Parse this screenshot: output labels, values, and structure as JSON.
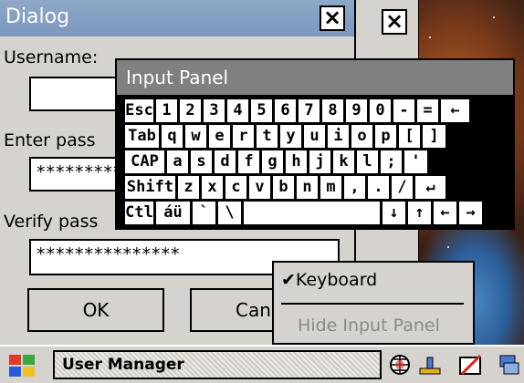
{
  "dialog": {
    "title": "Dialog",
    "username_label": "Username:",
    "username_value": "",
    "enter_pass_label": "Enter pass",
    "enter_pass_value": "*********",
    "verify_pass_label": "Verify pass",
    "verify_pass_value": "***************",
    "ok_label": "OK",
    "cancel_label": "Canc"
  },
  "input_panel": {
    "title": "Input Panel",
    "rows": [
      [
        "Esc",
        "1",
        "2",
        "3",
        "4",
        "5",
        "6",
        "7",
        "8",
        "9",
        "0",
        "-",
        "=",
        "←"
      ],
      [
        "Tab",
        "q",
        "w",
        "e",
        "r",
        "t",
        "y",
        "u",
        "i",
        "o",
        "p",
        "[",
        "]"
      ],
      [
        "CAP",
        "a",
        "s",
        "d",
        "f",
        "g",
        "h",
        "j",
        "k",
        "l",
        ";",
        "'"
      ],
      [
        "Shift",
        "z",
        "x",
        "c",
        "v",
        "b",
        "n",
        "m",
        ",",
        ".",
        "/",
        "↵"
      ],
      [
        "Ctl",
        "áü",
        "`",
        "\\",
        " ",
        "↓",
        "↑",
        "←",
        "→"
      ]
    ]
  },
  "menu": {
    "keyboard_label": "Keyboard",
    "keyboard_checked": true,
    "hide_panel_label": "Hide Input Panel"
  },
  "taskbar": {
    "task_label": "User Manager"
  },
  "colors": {
    "titlebar": "#7b97bd",
    "window_bg": "#d6d3ce",
    "panel_title": "#808080"
  }
}
